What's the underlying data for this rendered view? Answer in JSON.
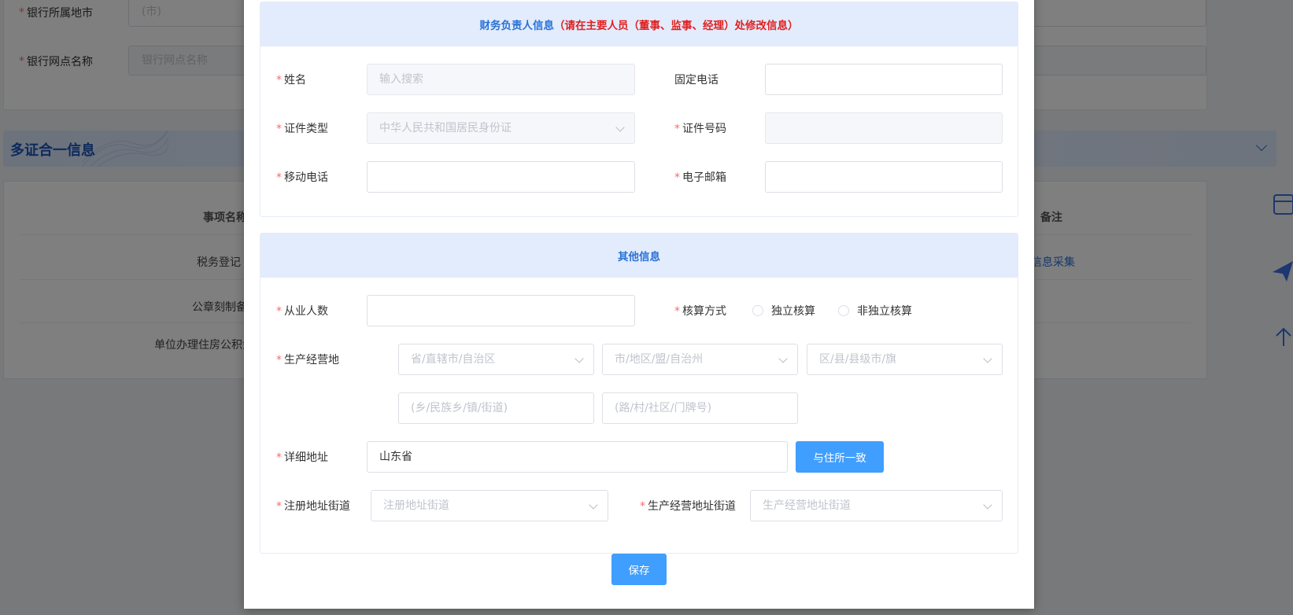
{
  "background": {
    "bank_city_label": "银行所属地市",
    "bank_city_value": "(市)",
    "bank_branch_label": "银行网点名称",
    "bank_branch_placeholder": "银行网点名称",
    "section_title": "多证合一信息",
    "table_headers": {
      "item_name": "事项名称",
      "remark": "备注"
    },
    "table_rows": [
      {
        "name": "税务登记",
        "remark": "信息采集"
      },
      {
        "name": "公章刻制备",
        "remark": ""
      },
      {
        "name": "单位办理住房公积金",
        "remark": ""
      }
    ]
  },
  "dialog": {
    "finance_section": {
      "title": "财务负责人信息",
      "warning": "（请在主要人员（董事、监事、经理）处修改信息）",
      "name_label": "姓名",
      "name_placeholder": "输入搜索",
      "landline_label": "固定电话",
      "landline_value": "",
      "id_type_label": "证件类型",
      "id_type_value": "中华人民共和国居民身份证",
      "id_number_label": "证件号码",
      "id_number_value": "",
      "mobile_label": "移动电话",
      "mobile_value": "",
      "email_label": "电子邮箱",
      "email_value": ""
    },
    "other_section": {
      "title": "其他信息",
      "employees_label": "从业人数",
      "employees_value": "",
      "accounting_label": "核算方式",
      "accounting_options": [
        "独立核算",
        "非独立核算"
      ],
      "site_label": "生产经营地",
      "province_placeholder": "省/直辖市/自治区",
      "city_placeholder": "市/地区/盟/自治州",
      "district_placeholder": "区/县/县级市/旗",
      "township_placeholder": "(乡/民族乡/镇/街道)",
      "road_placeholder": "(路/村/社区/门牌号)",
      "address_label": "详细地址",
      "address_value": "山东省",
      "same_as_residence_button": "与住所一致",
      "reg_street_label": "注册地址街道",
      "reg_street_placeholder": "注册地址街道",
      "prod_street_label": "生产经营地址街道",
      "prod_street_placeholder": "生产经营地址街道"
    },
    "save_button": "保存"
  },
  "colors": {
    "accent": "#409eff",
    "required": "#f56c6c",
    "section_header_bg": "#e2ecfd",
    "section_title": "#2b72d6",
    "warning": "#e02020"
  },
  "icons": [
    "chevron-down-icon",
    "card-icon",
    "send-icon",
    "arrow-up-icon"
  ]
}
